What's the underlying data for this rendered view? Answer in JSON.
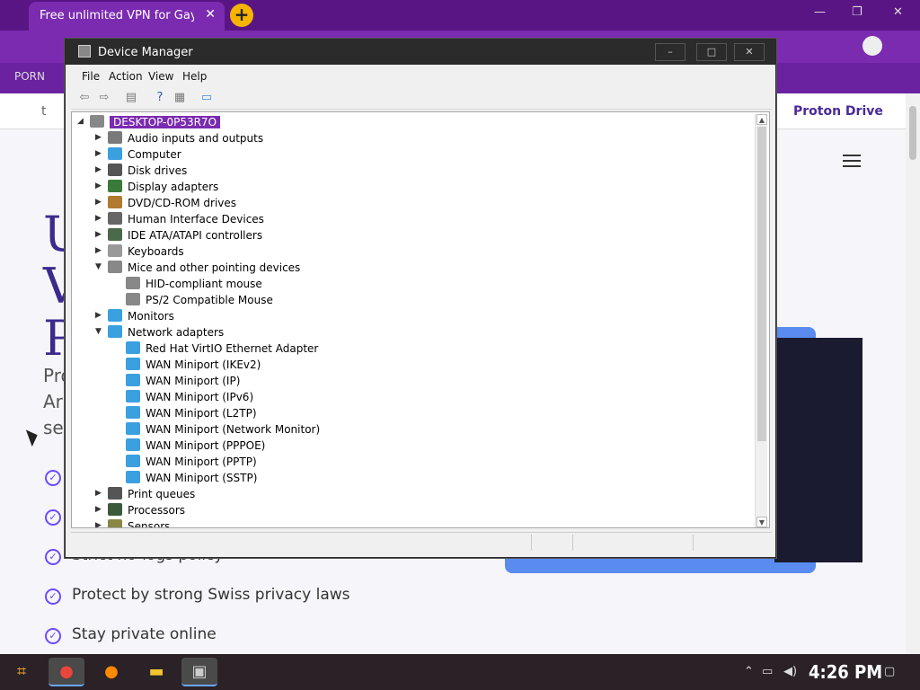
{
  "browser": {
    "tab_title": "Free unlimited VPN for Gay Ar",
    "tab_close": "✕",
    "new_tab": "+",
    "bookmark": "PORN",
    "window_minimize": "—",
    "window_restore": "❐",
    "window_close": "✕"
  },
  "website": {
    "twitter": "t",
    "brand": "Proton Drive",
    "hero_letters": [
      "U",
      "V",
      "P"
    ],
    "sub_letters": [
      "Pro",
      "Ar",
      "sel"
    ],
    "features": [
      "",
      "",
      "Strict no-logs policy",
      "Protect by strong Swiss privacy laws",
      "Stay private online"
    ]
  },
  "device_manager": {
    "title": "Device Manager",
    "menu": [
      "File",
      "Action",
      "View",
      "Help"
    ],
    "root": "DESKTOP-0P53R7O",
    "tree": [
      {
        "label": "Audio inputs and outputs",
        "expanded": false,
        "color": "#7a7a7a"
      },
      {
        "label": "Computer",
        "expanded": false,
        "color": "#3aa0e0"
      },
      {
        "label": "Disk drives",
        "expanded": false,
        "color": "#555555"
      },
      {
        "label": "Display adapters",
        "expanded": false,
        "color": "#3a7a3a"
      },
      {
        "label": "DVD/CD-ROM drives",
        "expanded": false,
        "color": "#b07a30"
      },
      {
        "label": "Human Interface Devices",
        "expanded": false,
        "color": "#666666"
      },
      {
        "label": "IDE ATA/ATAPI controllers",
        "expanded": false,
        "color": "#4a6a4a"
      },
      {
        "label": "Keyboards",
        "expanded": false,
        "color": "#999999"
      },
      {
        "label": "Mice and other pointing devices",
        "expanded": true,
        "color": "#888888",
        "children": [
          "HID-compliant mouse",
          "PS/2 Compatible Mouse"
        ]
      },
      {
        "label": "Monitors",
        "expanded": false,
        "color": "#3aa0e0"
      },
      {
        "label": "Network adapters",
        "expanded": true,
        "color": "#3aa0e0",
        "children": [
          "Red Hat VirtIO Ethernet Adapter",
          "WAN Miniport (IKEv2)",
          "WAN Miniport (IP)",
          "WAN Miniport (IPv6)",
          "WAN Miniport (L2TP)",
          "WAN Miniport (Network Monitor)",
          "WAN Miniport (PPPOE)",
          "WAN Miniport (PPTP)",
          "WAN Miniport (SSTP)"
        ]
      },
      {
        "label": "Print queues",
        "expanded": false,
        "color": "#555555"
      },
      {
        "label": "Processors",
        "expanded": false,
        "color": "#3a5a3a"
      },
      {
        "label": "Sensors",
        "expanded": false,
        "color": "#888844"
      }
    ]
  },
  "taskbar": {
    "clock": "4:26 PM"
  },
  "colors": {
    "accent": "#7b2bb0",
    "selection": "#7b2bb0"
  }
}
